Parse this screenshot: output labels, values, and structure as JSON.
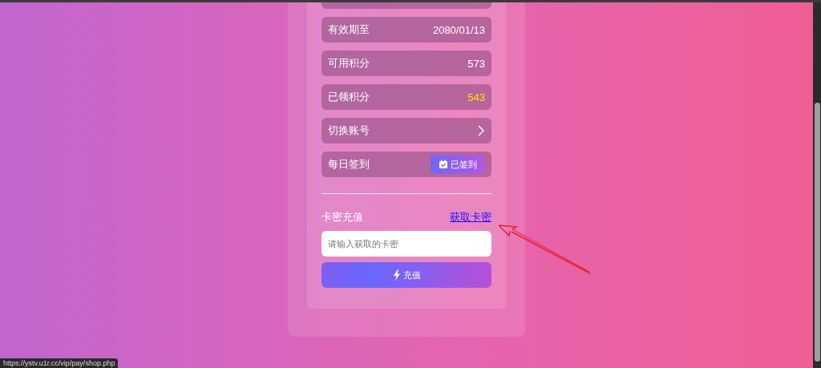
{
  "info_rows": [
    {
      "kind": "value",
      "label": "有效期至",
      "value": "2080/01/13",
      "highlight": false
    },
    {
      "kind": "value",
      "label": "可用积分",
      "value": "573",
      "highlight": false
    },
    {
      "kind": "value",
      "label": "已领积分",
      "value": "543",
      "highlight": true
    },
    {
      "kind": "link",
      "label": "切换账号"
    },
    {
      "kind": "checkin",
      "label": "每日签到",
      "button": "已签到",
      "checked": true
    }
  ],
  "recharge": {
    "title": "卡密充值",
    "link": "获取卡密",
    "placeholder": "请输入获取的卡密",
    "button": "充值"
  },
  "status_url": "https://ystv.u1r.cc/vip/pay/shop.php"
}
